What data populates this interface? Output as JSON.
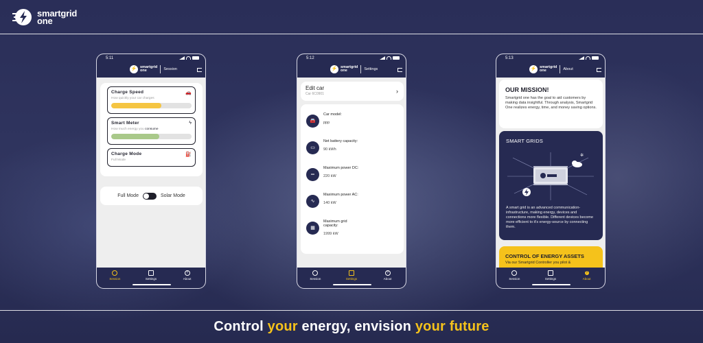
{
  "brand": {
    "line1": "smartgrid",
    "line2": "one"
  },
  "tagline": {
    "parts": [
      "Control ",
      "your",
      " energy, envision ",
      "your",
      " ",
      "future"
    ],
    "highlight_color": "#f5c21b"
  },
  "colors": {
    "navy": "#262a52",
    "accent": "#f5c21b",
    "speed_fill": "#f5c542",
    "meter_fill": "#a9c98a"
  },
  "phones": {
    "session": {
      "time": "5:11",
      "brand_line1": "smartgrid",
      "brand_line2": "one",
      "section": "Session",
      "charge_speed": {
        "title": "Charge Speed",
        "subtitle": "How quickly your car charges",
        "fill_fraction": 0.62,
        "icon": "car-icon"
      },
      "smart_meter": {
        "title": "Smart Meter",
        "subtitle_prefix": "How much energy you ",
        "subtitle_bold": "consume",
        "fill_fraction": 0.6,
        "icon": "lightning-icon"
      },
      "charge_mode": {
        "title": "Charge Mode",
        "subtitle": "Full Mode",
        "icon": "charger-icon"
      },
      "mode_toggle": {
        "left": "Full Mode",
        "right": "Solar Mode"
      },
      "nav": [
        "Session",
        "Settings",
        "About"
      ],
      "active_nav": 0
    },
    "settings": {
      "time": "5:12",
      "brand_line1": "smartgrid",
      "brand_line2": "one",
      "section": "Settings",
      "edit": {
        "title": "Edit car",
        "subtitle": "Car 6C0901",
        "chevron": "›"
      },
      "specs": [
        {
          "label": "Car model:",
          "value": "ppp",
          "icon": "car-icon"
        },
        {
          "label": "Net battery capacity:",
          "value": "90 kWh",
          "icon": "battery-icon"
        },
        {
          "label": "Maximum power DC:",
          "value": "220 kW",
          "icon": "dc-icon"
        },
        {
          "label": "Maximum power AC:",
          "value": "140 kW",
          "icon": "ac-icon"
        },
        {
          "label": "Maximum grid capacity:",
          "value": "1999 kW",
          "icon": "grid-icon"
        }
      ],
      "nav": [
        "Session",
        "Settings",
        "About"
      ],
      "active_nav": 1
    },
    "about": {
      "time": "5:13",
      "brand_line1": "smartgrid",
      "brand_line2": "one",
      "section": "About",
      "mission": {
        "title": "OUR MISSION!",
        "text": "Smartgrid one has the goal to aid customers by making data insightful. Through analysis, Smartgrid One realizes energy, time, and money saving options."
      },
      "smart_grids": {
        "title": "SMART GRIDS",
        "text": "A smart grid is an advanced communication-infrastructure, making energy, devices and connections more flexible. Different devices become more efficient to it's energy-source by connecting them."
      },
      "control": {
        "title": "CONTROL OF ENERGY ASSETS",
        "text": "Via our Smartgrid Controller you pilot &"
      },
      "nav": [
        "Session",
        "Settings",
        "About"
      ],
      "active_nav": 2
    }
  }
}
